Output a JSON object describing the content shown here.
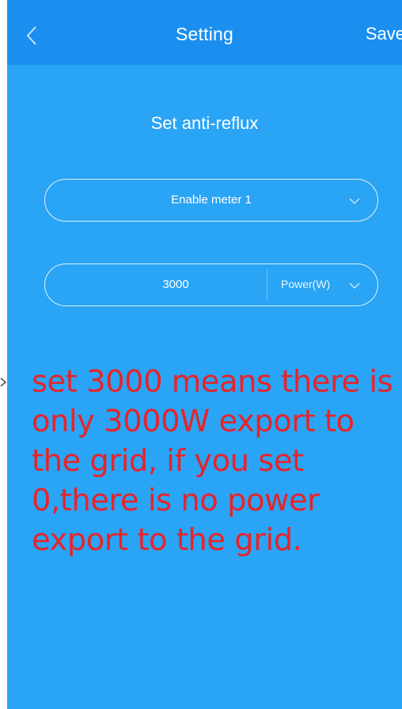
{
  "navbar": {
    "title": "Setting",
    "save_label": "Save"
  },
  "main": {
    "section_title": "Set anti-reflux",
    "meter_select": {
      "selected": "Enable meter 1"
    },
    "power_field": {
      "value": "3000",
      "unit_selected": "Power(W)"
    }
  },
  "annotation": {
    "text": "set 3000 means there is only 3000W export to the grid, if you set 0,there is no power export to the grid."
  },
  "colors": {
    "screen_bg": "#2aa4f4",
    "navbar_bg": "#1a8ff0",
    "annotation": "#e8232a"
  },
  "icons": [
    "back-chevron-icon",
    "chevron-down-icon",
    "arrow-tip-icon"
  ]
}
